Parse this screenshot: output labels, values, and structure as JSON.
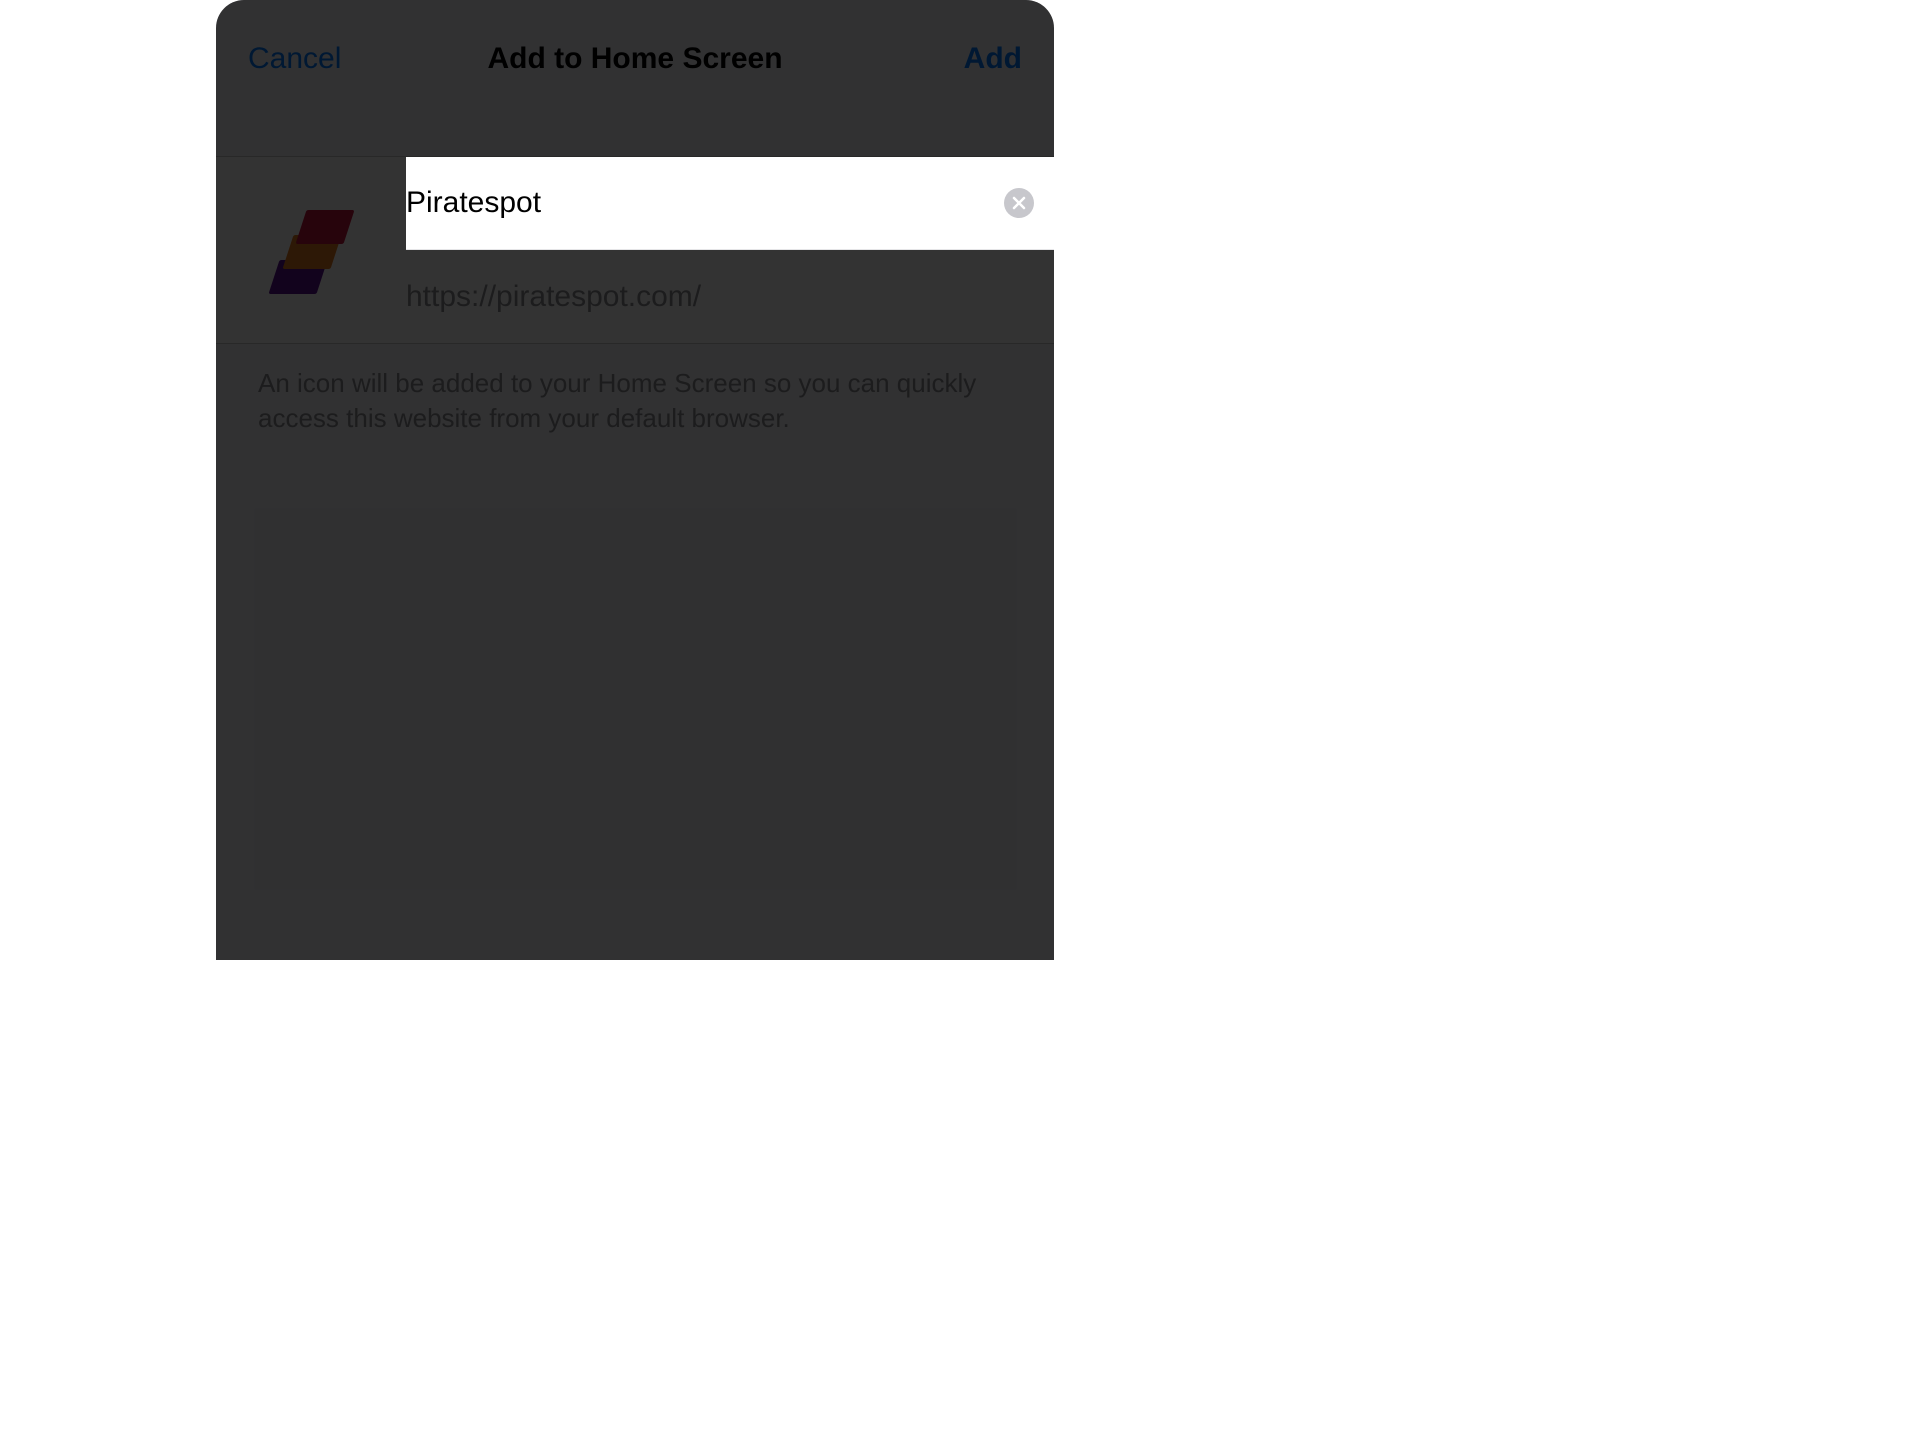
{
  "header": {
    "cancel_label": "Cancel",
    "title": "Add to Home Screen",
    "add_label": "Add"
  },
  "content": {
    "name_value": "Piratespot",
    "url": "https://piratespot.com/"
  },
  "description": "An icon will be added to your Home Screen so you can quickly access this website from your default browser."
}
